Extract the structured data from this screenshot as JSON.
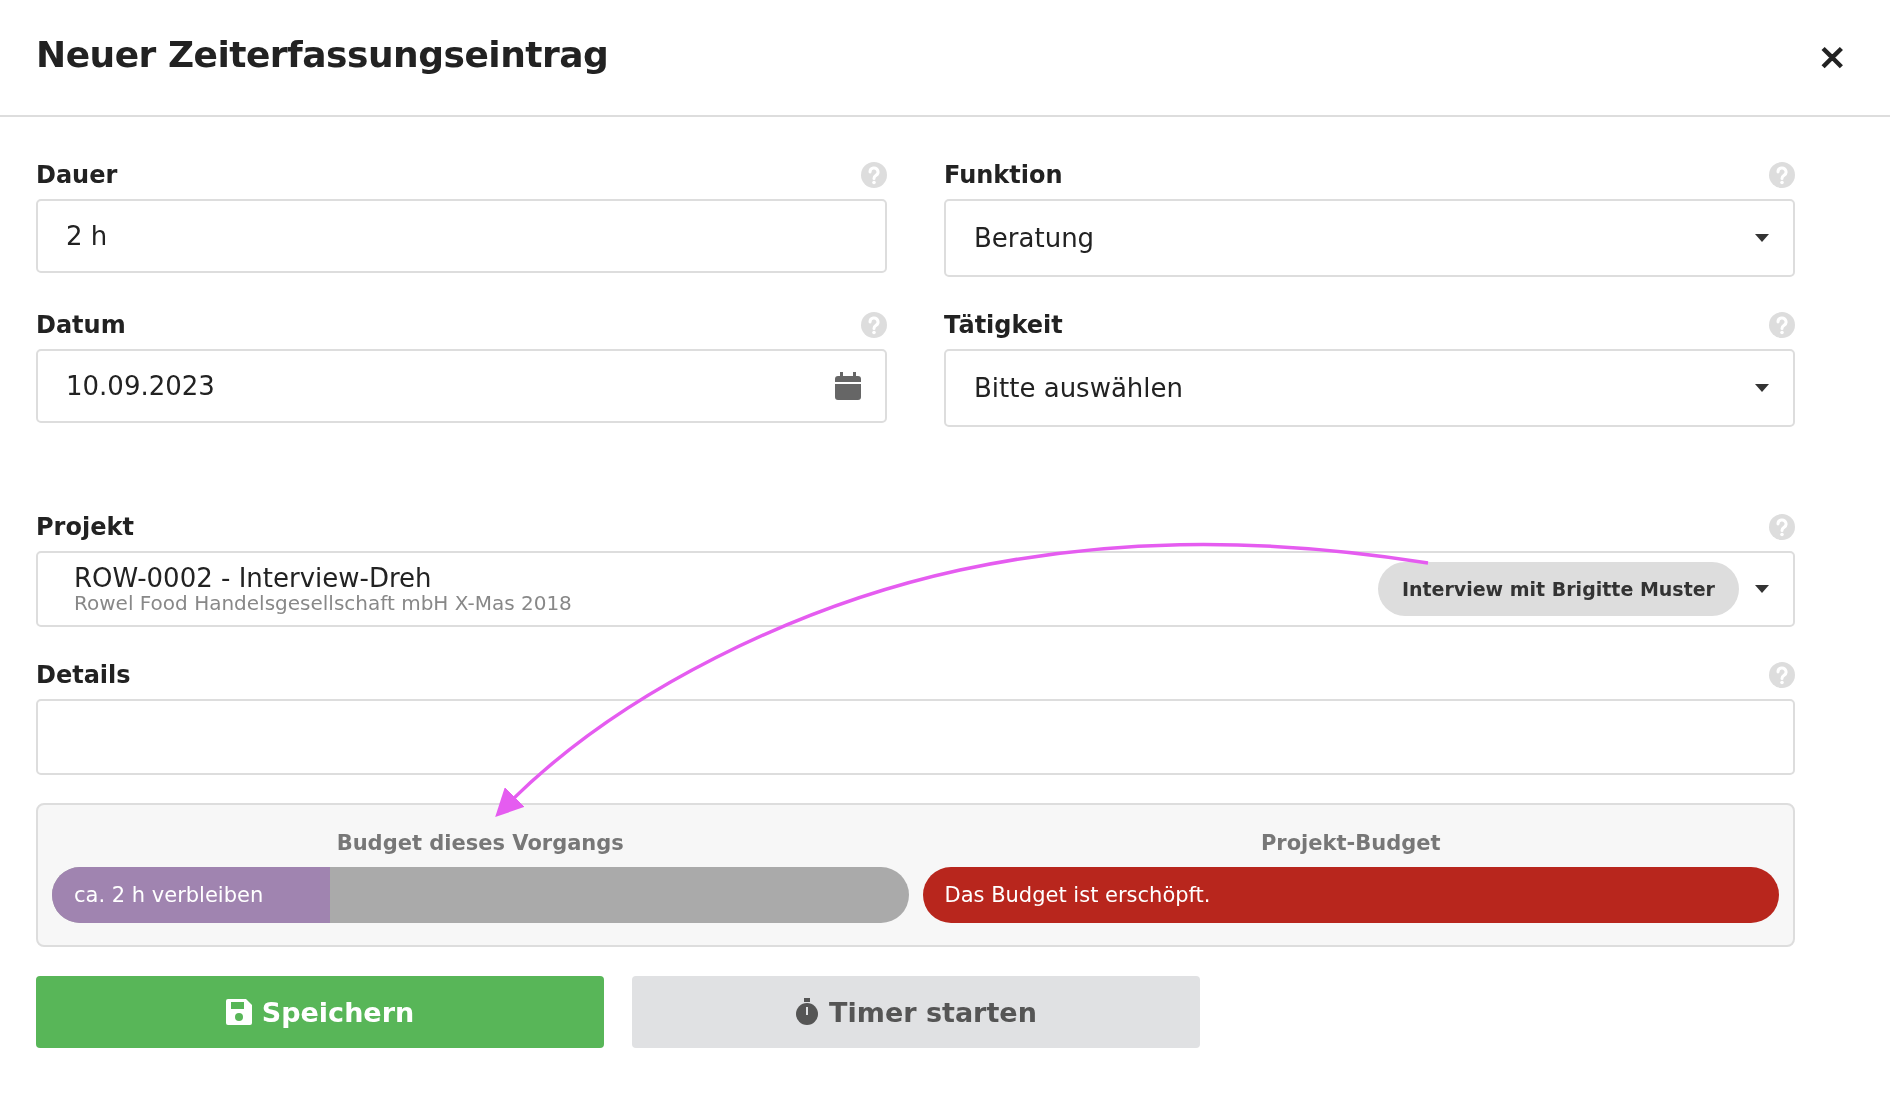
{
  "dialog": {
    "title": "Neuer Zeiterfassungseintrag",
    "close": "✕"
  },
  "rows": [
    [
      {
        "label": "Dauer",
        "kind": "text",
        "value": "2 h"
      },
      {
        "label": "Funktion",
        "kind": "select",
        "value": "Beratung"
      }
    ],
    [
      {
        "label": "Datum",
        "kind": "date",
        "value": "10.09.2023"
      },
      {
        "label": "Tätigkeit",
        "kind": "select",
        "value": "Bitte auswählen"
      }
    ]
  ],
  "project": {
    "label": "Projekt",
    "title": "ROW-0002 - Interview-Dreh",
    "subtitle": "Rowel Food Handelsgesellschaft mbH X-Mas 2018",
    "tag": "Interview mit Brigitte Muster"
  },
  "details": {
    "label": "Details"
  },
  "budgets": [
    {
      "title": "Budget dieses Vorgangs",
      "text": "ca. 2 h verbleiben",
      "kind": "remaining",
      "level": 0.325,
      "color": "#a084b0"
    },
    {
      "title": "Projekt-Budget",
      "text": "Das Budget ist erschöpft.",
      "kind": "exhausted",
      "color": "#b8261d"
    }
  ],
  "buttons": [
    {
      "kind": "primary",
      "label": "Speichern"
    },
    {
      "kind": "secondary",
      "label": "Timer starten"
    }
  ]
}
